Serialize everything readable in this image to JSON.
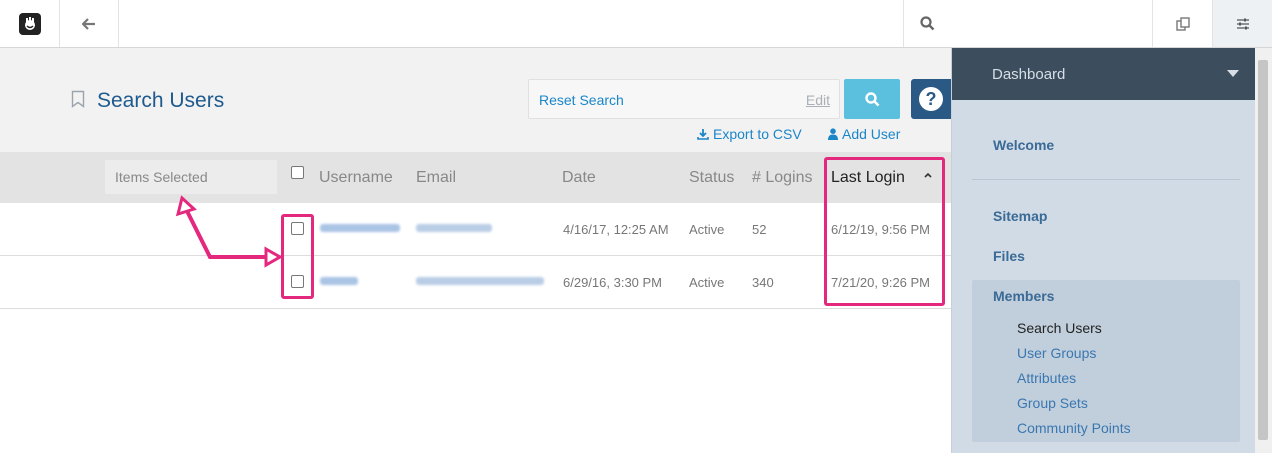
{
  "toolbar": {
    "logo_icon": "concrete5-logo-icon",
    "back_icon": "arrow-left-icon",
    "search_icon": "search-icon",
    "copy_icon": "copy-icon",
    "settings_icon": "sliders-icon"
  },
  "header": {
    "title": "Search Users",
    "bookmark_icon": "bookmark-icon",
    "reset_search": "Reset Search",
    "edit": "Edit",
    "export": "Export to CSV",
    "add_user": "Add User",
    "help": "?"
  },
  "table": {
    "items_selected": "Items Selected",
    "columns": {
      "username": "Username",
      "email": "Email",
      "date": "Date",
      "status": "Status",
      "logins": "# Logins",
      "last_login": "Last Login"
    },
    "rows": [
      {
        "date": "4/16/17, 12:25 AM",
        "status": "Active",
        "logins": "52",
        "last_login": "6/12/19, 9:56 PM"
      },
      {
        "date": "6/29/16, 3:30 PM",
        "status": "Active",
        "logins": "340",
        "last_login": "7/21/20, 9:26 PM"
      }
    ]
  },
  "panel": {
    "dashboard": "Dashboard",
    "welcome": "Welcome",
    "sitemap": "Sitemap",
    "files": "Files",
    "members": "Members",
    "members_items": [
      "Search Users",
      "User Groups",
      "Attributes",
      "Group Sets",
      "Community Points"
    ]
  },
  "colors": {
    "accent": "#1a86c8",
    "highlight": "#e4287e",
    "panel_head": "#3c4e5e",
    "search_button": "#5bc0de"
  }
}
